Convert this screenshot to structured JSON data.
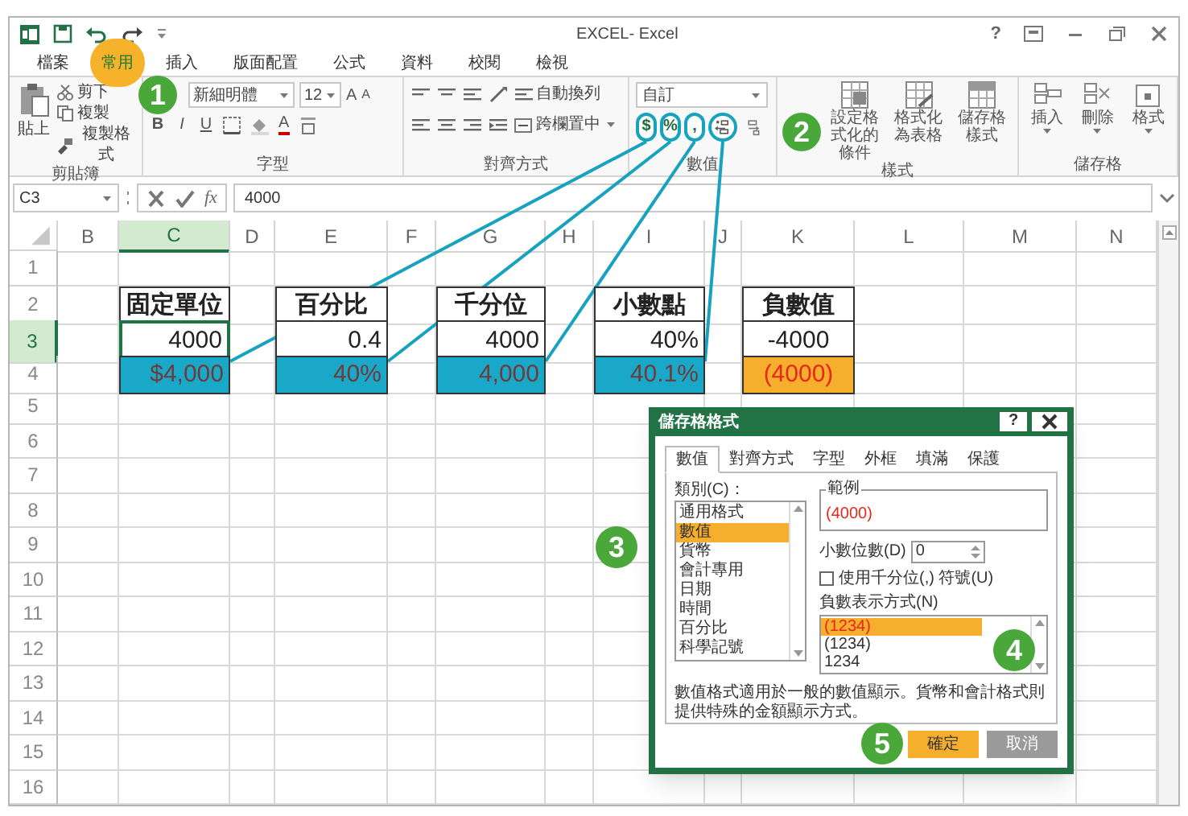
{
  "window": {
    "title": "EXCEL- Excel",
    "help": "?"
  },
  "ribbon_tabs": [
    {
      "label": "檔案",
      "selected": false
    },
    {
      "label": "常用",
      "selected": true
    },
    {
      "label": "插入",
      "selected": false
    },
    {
      "label": "版面配置",
      "selected": false
    },
    {
      "label": "公式",
      "selected": false
    },
    {
      "label": "資料",
      "selected": false
    },
    {
      "label": "校閱",
      "selected": false
    },
    {
      "label": "檢視",
      "selected": false
    }
  ],
  "clipboard": {
    "paste": "貼上",
    "cut": "剪下",
    "copy": "複製",
    "format_painter": "複製格式",
    "label": "剪貼簿"
  },
  "font": {
    "name": "新細明體",
    "size": "12",
    "grow": "A",
    "shrink": "A",
    "styles": [
      "B",
      "I",
      "U"
    ],
    "font_color": "A",
    "label": "字型"
  },
  "alignment": {
    "wrap": "自動換列",
    "merge": "跨欄置中",
    "label": "對齊方式"
  },
  "number": {
    "format": "自訂",
    "buttons": [
      {
        "kind": "currency",
        "symbol": "$",
        "highlighted": true
      },
      {
        "kind": "percent",
        "symbol": "%",
        "highlighted": true
      },
      {
        "kind": "comma",
        "symbol": ",",
        "highlighted": true
      },
      {
        "kind": "increase_decimal",
        "highlighted": true
      },
      {
        "kind": "decrease_decimal",
        "highlighted": false
      }
    ],
    "label": "數值"
  },
  "styles": {
    "items": [
      "設定格式化的條件",
      "格式化為表格",
      "儲存格樣式"
    ],
    "label": "樣式"
  },
  "cells_group": {
    "items": [
      "插入",
      "刪除",
      "格式"
    ],
    "label": "儲存格"
  },
  "formula_bar": {
    "name_box": "C3",
    "function_label": "fx",
    "value": "4000"
  },
  "columns": [
    {
      "label": "B",
      "selected": false
    },
    {
      "label": "C",
      "selected": true
    },
    {
      "label": "D",
      "selected": false
    },
    {
      "label": "E",
      "selected": false
    },
    {
      "label": "F",
      "selected": false
    },
    {
      "label": "G",
      "selected": false
    },
    {
      "label": "H",
      "selected": false
    },
    {
      "label": "I",
      "selected": false
    },
    {
      "label": "J",
      "selected": false
    },
    {
      "label": "K",
      "selected": false
    },
    {
      "label": "L",
      "selected": false
    },
    {
      "label": "M",
      "selected": false
    },
    {
      "label": "N",
      "selected": false
    }
  ],
  "rows": [
    {
      "label": "1",
      "selected": false
    },
    {
      "label": "2",
      "selected": false
    },
    {
      "label": "3",
      "selected": true
    },
    {
      "label": "4",
      "selected": false
    },
    {
      "label": "5",
      "selected": false
    },
    {
      "label": "6",
      "selected": false
    },
    {
      "label": "7",
      "selected": false
    },
    {
      "label": "8",
      "selected": false
    },
    {
      "label": "9",
      "selected": false
    },
    {
      "label": "10",
      "selected": false
    },
    {
      "label": "11",
      "selected": false
    },
    {
      "label": "12",
      "selected": false
    },
    {
      "label": "13",
      "selected": false
    },
    {
      "label": "14",
      "selected": false
    },
    {
      "label": "15",
      "selected": false
    },
    {
      "label": "16",
      "selected": false
    }
  ],
  "tables": [
    {
      "header": "固定單位",
      "value": "4000",
      "result": "$4,000",
      "color": "#1aa8c9",
      "negative_red": false
    },
    {
      "header": "百分比",
      "value": "0.4",
      "result": "40%",
      "color": "#1aa8c9",
      "negative_red": false
    },
    {
      "header": "千分位",
      "value": "4000",
      "result": "4,000",
      "color": "#1aa8c9",
      "negative_red": false
    },
    {
      "header": "小數點",
      "value": "40%",
      "result": "40.1%",
      "color": "#1aa8c9",
      "negative_red": false
    },
    {
      "header": "負數值",
      "value": "-4000",
      "result": "(4000)",
      "color": "#f6ae2d",
      "negative_red": true
    }
  ],
  "dialog": {
    "title": "儲存格格式",
    "help": "?",
    "tabs": [
      {
        "label": "數值",
        "selected": true
      },
      {
        "label": "對齊方式",
        "selected": false
      },
      {
        "label": "字型",
        "selected": false
      },
      {
        "label": "外框",
        "selected": false
      },
      {
        "label": "填滿",
        "selected": false
      },
      {
        "label": "保護",
        "selected": false
      }
    ],
    "category_label": "類別(C)：",
    "categories": [
      {
        "label": "通用格式",
        "selected": false
      },
      {
        "label": "數值",
        "selected": true
      },
      {
        "label": "貨幣",
        "selected": false
      },
      {
        "label": "會計專用",
        "selected": false
      },
      {
        "label": "日期",
        "selected": false
      },
      {
        "label": "時間",
        "selected": false
      },
      {
        "label": "百分比",
        "selected": false
      },
      {
        "label": "科學記號",
        "selected": false
      }
    ],
    "sample_label": "範例",
    "sample": "(4000)",
    "decimals_label": "小數位數(D)",
    "decimals": "0",
    "thousands": {
      "label": "使用千分位(,) 符號(U)",
      "checked": false
    },
    "negative_label": "負數表示方式(N)",
    "negative_formats": [
      {
        "label": "(1234)",
        "selected": true,
        "red": true
      },
      {
        "label": "(1234)",
        "selected": false,
        "red": false
      },
      {
        "label": "1234",
        "selected": false,
        "red": false
      }
    ],
    "description": "數值格式適用於一般的數值顯示。貨幣和會計格式則提供特殊的金額顯示方式。",
    "buttons": [
      {
        "label": "確定",
        "kind": "primary"
      },
      {
        "label": "取消",
        "kind": "secondary"
      }
    ]
  },
  "callouts": [
    "1",
    "2",
    "3",
    "4",
    "5"
  ]
}
